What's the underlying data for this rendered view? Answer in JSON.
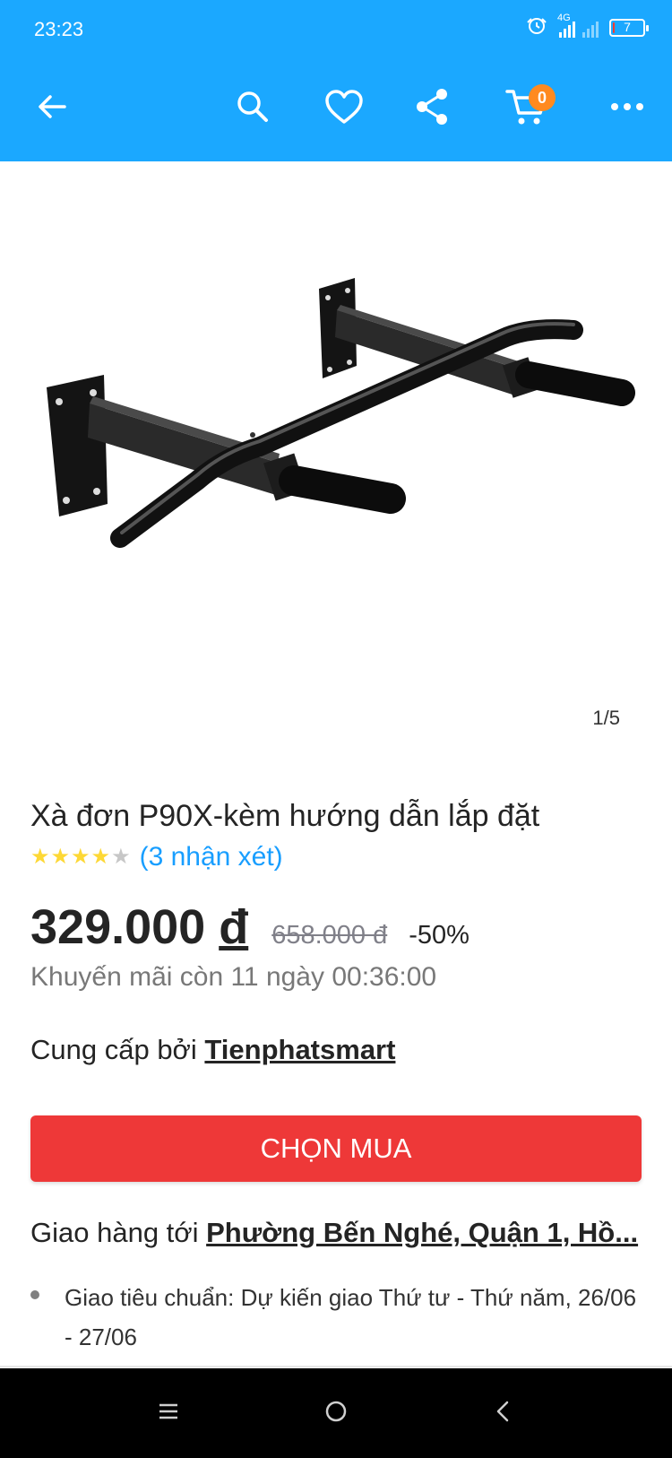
{
  "status_bar": {
    "time": "23:23",
    "network": "4G",
    "battery": "7",
    "battery_level": 0.07,
    "icons": [
      "alarm-icon",
      "signal-icon",
      "battery-icon"
    ]
  },
  "top_nav": {
    "background": "#1ba8ff",
    "icons": [
      "back-arrow-icon",
      "search-icon",
      "heart-icon",
      "share-icon",
      "cart-icon",
      "more-icon"
    ],
    "cart_count": "0",
    "badge_color": "#ff8a1f"
  },
  "gallery": {
    "counter": "1/5",
    "image": "pull-up-bar-image"
  },
  "product": {
    "title": "Xà đơn P90X-kèm hướng dẫn lắp đặt",
    "rating": 4,
    "rating_max": 5,
    "review_link": "(3 nhận xét)",
    "price_value": "329.000",
    "price_currency": "đ",
    "old_price": "658.000 đ",
    "discount": "-50%",
    "promo": "Khuyến mãi còn 11 ngày 00:36:00"
  },
  "seller": {
    "prefix": "Cung cấp bởi",
    "name": "Tienphatsmart"
  },
  "buy_button": {
    "label": "CHỌN MUA",
    "color": "#ee3838"
  },
  "shipping": {
    "prefix": "Giao hàng tới",
    "address": "Phường Bến Nghé, Quận 1, Hồ...",
    "detail": "Giao tiêu chuẩn: Dự kiến giao Thứ tư - Thứ năm, 26/06 - 27/06"
  },
  "system_nav": {
    "icons": [
      "menu-icon",
      "home-icon",
      "back-icon"
    ]
  },
  "colors": {
    "link": "#189eff",
    "star": "#fdd836",
    "star_empty": "#c7c7c7"
  }
}
